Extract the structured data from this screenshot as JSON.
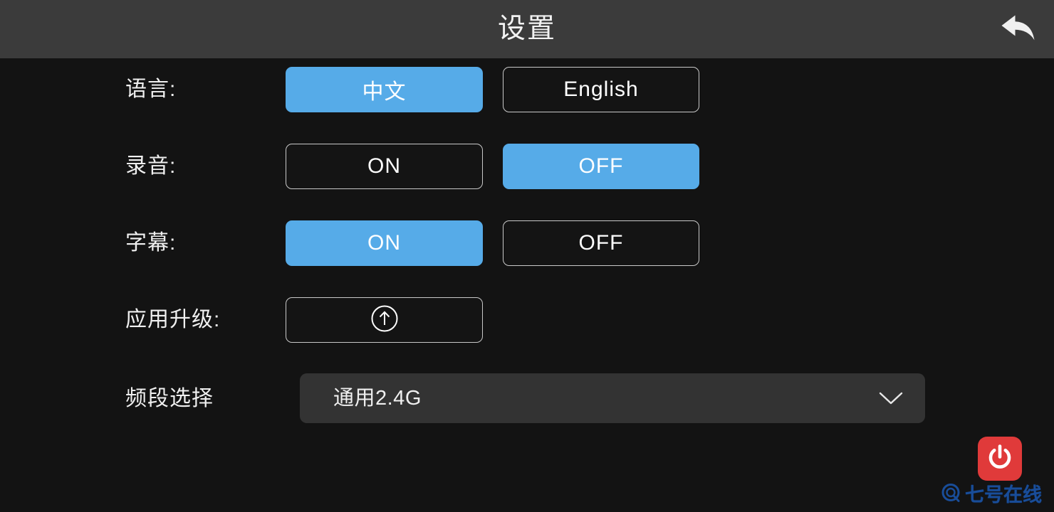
{
  "header": {
    "title": "设置",
    "back_icon": "back-arrow-icon"
  },
  "settings": {
    "rows": [
      {
        "id": "language",
        "label": "语言:",
        "options": [
          {
            "label": "中文",
            "selected": true
          },
          {
            "label": "English",
            "selected": false
          }
        ]
      },
      {
        "id": "recording",
        "label": "录音:",
        "options": [
          {
            "label": "ON",
            "selected": false
          },
          {
            "label": "OFF",
            "selected": true
          }
        ]
      },
      {
        "id": "subtitle",
        "label": "字幕:",
        "options": [
          {
            "label": "ON",
            "selected": true
          },
          {
            "label": "OFF",
            "selected": false
          }
        ]
      }
    ],
    "upgrade": {
      "label": "应用升级:",
      "icon": "circle-up-arrow-icon"
    },
    "band": {
      "label": "频段选择",
      "value": "通用2.4G",
      "caret_icon": "chevron-down-icon"
    }
  },
  "power": {
    "icon": "power-icon"
  },
  "watermark": {
    "text": "七号在线",
    "icon": "magnifier-q-icon",
    "color": "#1a4f9c"
  },
  "colors": {
    "header_bg": "#3b3b3b",
    "page_bg": "#131313",
    "accent_blue": "#56abe8",
    "button_border": "#c9c9c9",
    "button_bg": "#141414",
    "dropdown_bg": "#333333",
    "power_red": "#e03a3a"
  }
}
